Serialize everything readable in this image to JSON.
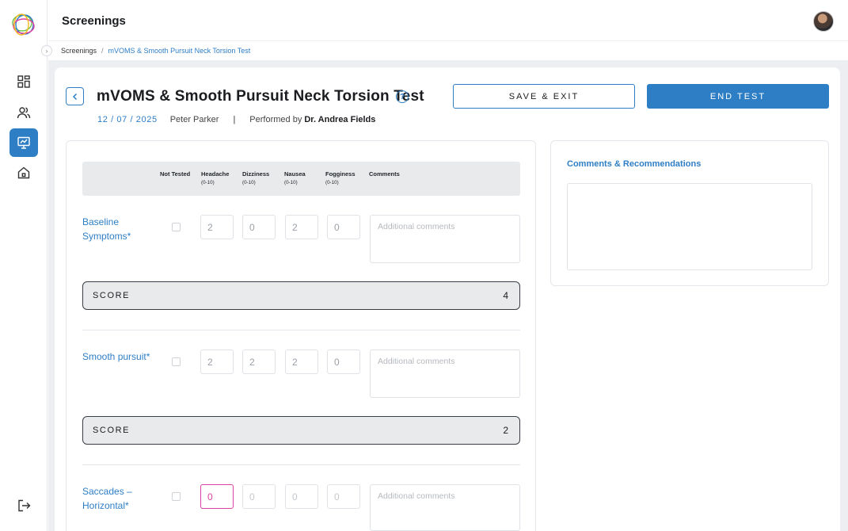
{
  "topbar": {
    "title": "Screenings"
  },
  "breadcrumb": {
    "root": "Screenings",
    "separator": "/",
    "current": "mVOMS & Smooth Pursuit Neck Torsion Test"
  },
  "sidebar": {
    "items": [
      {
        "name": "dashboard",
        "icon": "dashboard-icon"
      },
      {
        "name": "users",
        "icon": "users-icon"
      },
      {
        "name": "screenings",
        "icon": "monitor-icon",
        "active": true
      },
      {
        "name": "home",
        "icon": "home-icon"
      }
    ],
    "logout_icon": "logout-icon"
  },
  "header": {
    "title": "mVOMS & Smooth Pursuit Neck Torsion Test",
    "date": "12 / 07 / 2025",
    "patient": "Peter Parker",
    "divider": "|",
    "performed_by_label": "Performed by",
    "performer": "Dr. Andrea Fields",
    "save_label": "SAVE & EXIT",
    "end_label": "END TEST",
    "help_glyph": "?"
  },
  "table": {
    "columns": [
      {
        "label": "Not Tested",
        "sub": ""
      },
      {
        "label": "Headache",
        "sub": "(0-10)"
      },
      {
        "label": "Dizziness",
        "sub": "(0-10)"
      },
      {
        "label": "Nausea",
        "sub": "(0-10)"
      },
      {
        "label": "Fogginess",
        "sub": "(0-10)"
      },
      {
        "label": "Comments",
        "sub": ""
      }
    ],
    "comments_placeholder": "Additional comments",
    "score_label": "SCORE",
    "rows": [
      {
        "label_line1": "Baseline",
        "label_line2": "Symptoms*",
        "values": [
          "2",
          "0",
          "2",
          "0"
        ],
        "score": "4"
      },
      {
        "label_line1": "Smooth pursuit*",
        "label_line2": "",
        "values": [
          "2",
          "2",
          "2",
          "0"
        ],
        "score": "2"
      },
      {
        "label_line1": "Saccades –",
        "label_line2": "Horizontal*",
        "values": [
          "0",
          "0",
          "0",
          "0"
        ],
        "score": ""
      }
    ]
  },
  "recommendations": {
    "title": "Comments & Recommendations"
  },
  "colors": {
    "accent": "#2e7ec5",
    "focus": "#e040a0",
    "score_bg": "#e9eaec"
  }
}
